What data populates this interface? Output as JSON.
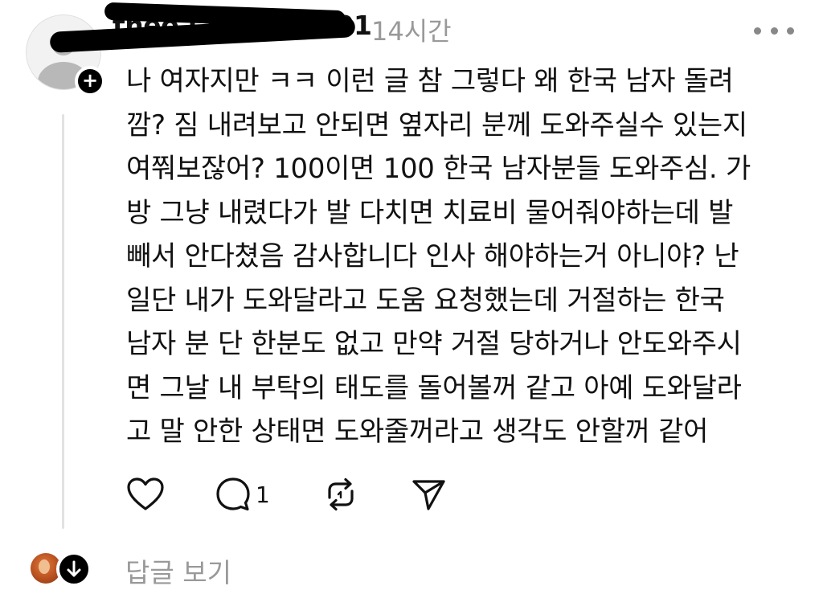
{
  "post": {
    "username": "theo · · · · · · · · 01",
    "timestamp": "14시간",
    "text_lines": [
      "나 여자지만 ㅋㅋ 이런 글 참 그렇다 왜 한국 남자 돌려",
      "깜? 짐 내려보고 안되면 옆자리 분께 도와주실수 있는지",
      "여쭤보잖어? 100이면 100 한국 남자분들 도와주심. 가",
      "방 그냥 내렸다가 발 다치면 치료비 물어줘야하는데 발",
      "빼서 안다쳤음 감사합니다 인사 해야하는거 아니야? 난",
      "일단 내가 도와달라고 도움 요청했는데 거절하는 한국",
      "남자 분 단 한분도 없고 만약 거절 당하거나 안도와주시",
      "면 그날 내 부탁의 태도를 돌어볼꺼 같고 아예 도와달라",
      "고 말 안한 상태면 도와줄꺼라고 생각도 안할꺼 같어"
    ],
    "reply_count": "1"
  },
  "footer": {
    "view_replies_label": "답글 보기"
  },
  "icons": {
    "more": "more-horizontal-icon",
    "like": "heart-icon",
    "reply": "comment-icon",
    "repost": "repost-icon",
    "share": "send-icon",
    "follow": "plus-icon",
    "expand": "arrow-down-icon"
  }
}
